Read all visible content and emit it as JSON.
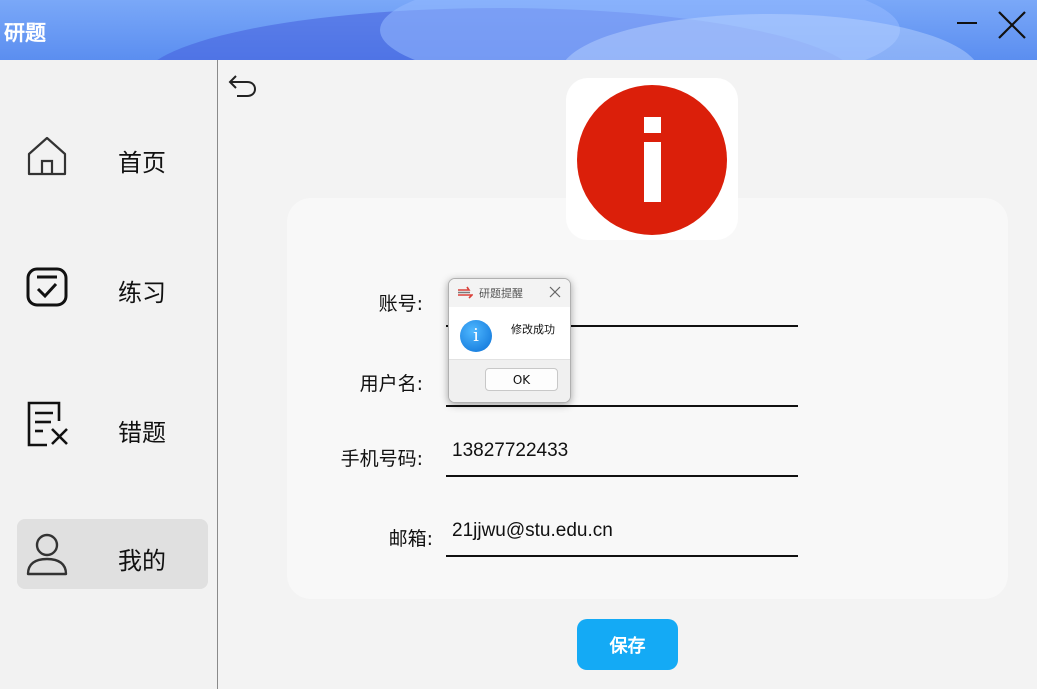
{
  "window": {
    "title": "研题"
  },
  "sidebar": {
    "items": [
      {
        "label": "首页",
        "icon": "home-icon"
      },
      {
        "label": "练习",
        "icon": "checkbox-icon"
      },
      {
        "label": "错题",
        "icon": "wrong-doc-icon"
      },
      {
        "label": "我的",
        "icon": "user-icon",
        "active": true
      }
    ]
  },
  "profile": {
    "avatar_icon": "info-icon",
    "avatar_color": "#db1f0a",
    "fields": [
      {
        "label": "账号:",
        "value": ""
      },
      {
        "label": "用户名:",
        "value": ""
      },
      {
        "label": "手机号码:",
        "value": "13827722433"
      },
      {
        "label": "邮箱:",
        "value": "21jjwu@stu.edu.cn"
      }
    ],
    "save_label": "保存",
    "save_color": "#14aaf5"
  },
  "dialog": {
    "title": "研题提醒",
    "message": "修改成功",
    "ok_label": "OK",
    "icon": "info-icon"
  }
}
